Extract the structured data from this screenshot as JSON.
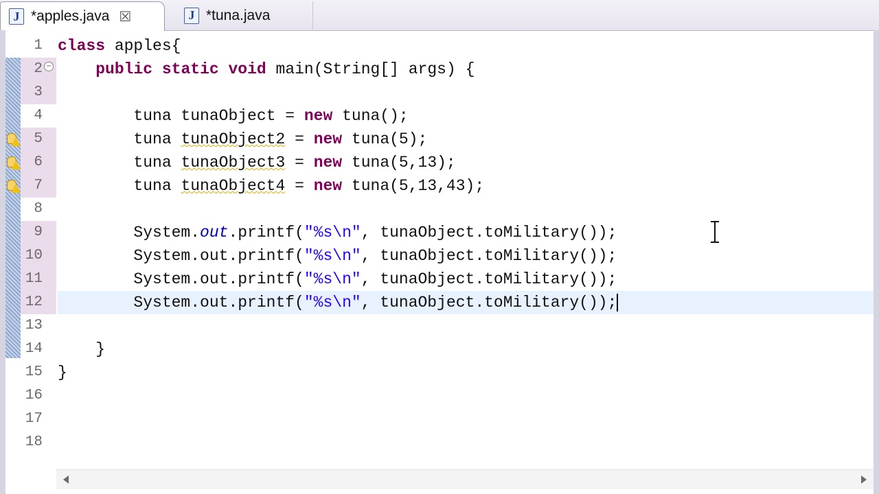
{
  "tabs": [
    {
      "label": "*apples.java",
      "icon": "java-file-icon",
      "active": true
    },
    {
      "label": "*tuna.java",
      "icon": "java-file-icon",
      "active": false
    }
  ],
  "editor": {
    "line_numbers": [
      "1",
      "2",
      "3",
      "4",
      "5",
      "6",
      "7",
      "8",
      "9",
      "10",
      "11",
      "12",
      "13",
      "14",
      "15",
      "16",
      "17",
      "18"
    ],
    "current_line": 12,
    "lines": [
      "class apples{",
      "    public static void main(String[] args) {",
      "",
      "        tuna tunaObject = new tuna();",
      "        tuna tunaObject2 = new tuna(5);",
      "        tuna tunaObject3 = new tuna(5,13);",
      "        tuna tunaObject4 = new tuna(5,13,43);",
      "",
      "        System.out.printf(\"%s\\n\", tunaObject.toMilitary());",
      "        System.out.printf(\"%s\\n\", tunaObject.toMilitary());",
      "        System.out.printf(\"%s\\n\", tunaObject.toMilitary());",
      "        System.out.printf(\"%s\\n\", tunaObject.toMilitary());",
      "",
      "    }",
      "}",
      "",
      "",
      ""
    ],
    "warning_lines": [
      5,
      6,
      7
    ],
    "modified_lines": [
      2,
      3,
      5,
      6,
      7,
      9,
      10,
      11,
      12
    ]
  },
  "colors": {
    "keyword": "#7f0055",
    "string": "#2a00ff",
    "field": "#0000c0",
    "current_line": "#e8f2fe"
  }
}
